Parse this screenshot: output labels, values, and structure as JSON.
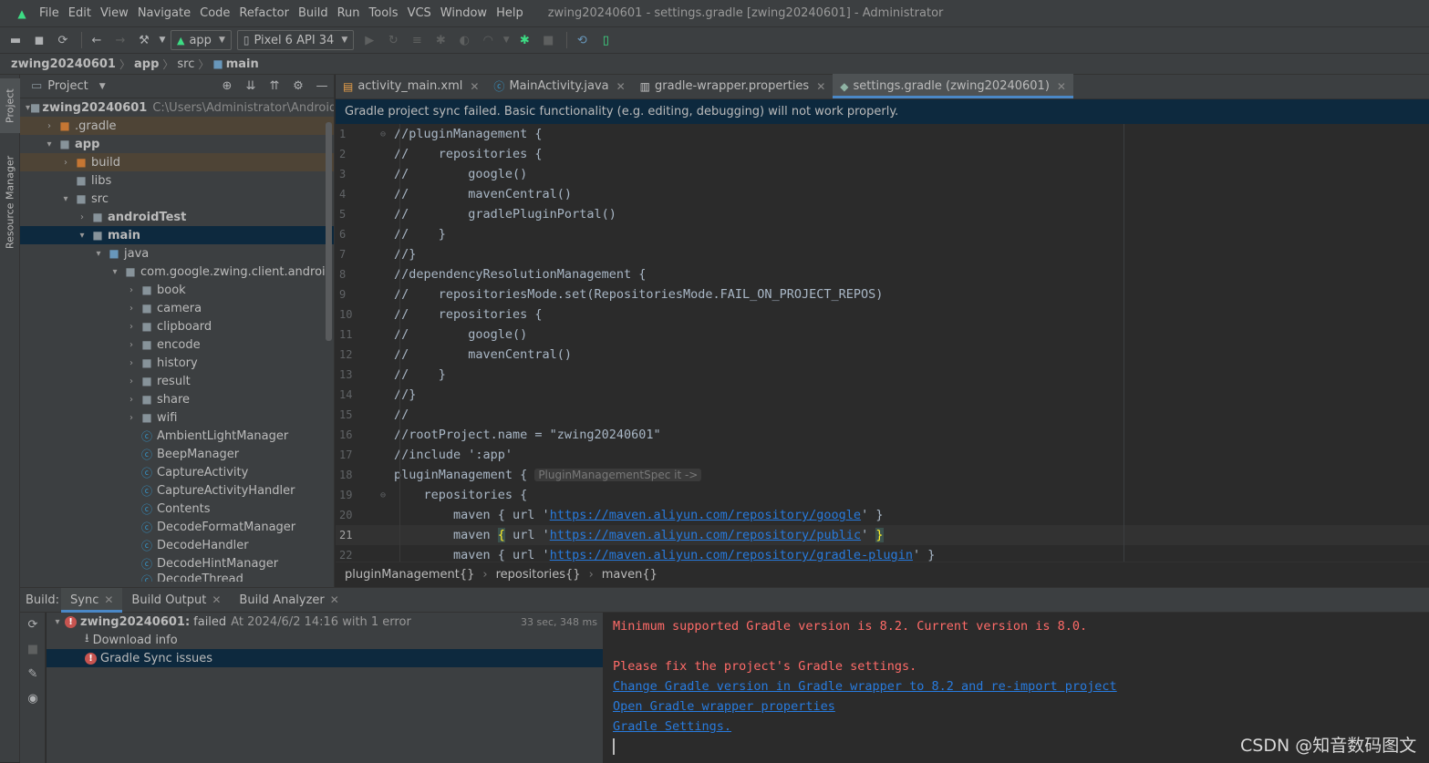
{
  "menubar": {
    "items": [
      "File",
      "Edit",
      "View",
      "Navigate",
      "Code",
      "Refactor",
      "Build",
      "Run",
      "Tools",
      "VCS",
      "Window",
      "Help"
    ],
    "title": "zwing20240601 - settings.gradle [zwing20240601] - Administrator"
  },
  "toolbar": {
    "config": "app",
    "device": "Pixel 6 API 34"
  },
  "navbar": {
    "crumbs": [
      "zwing20240601",
      "app",
      "src",
      "main"
    ]
  },
  "leftstrip": {
    "project_tab": "Project",
    "resource_tab": "Resource Manager"
  },
  "project": {
    "header": "Project",
    "tree": [
      {
        "label": "zwing20240601",
        "path": "C:\\Users\\Administrator\\AndroidStu"
      },
      {
        "label": ".gradle"
      },
      {
        "label": "app"
      },
      {
        "label": "build"
      },
      {
        "label": "libs"
      },
      {
        "label": "src"
      },
      {
        "label": "androidTest"
      },
      {
        "label": "main"
      },
      {
        "label": "java"
      },
      {
        "label": "com.google.zwing.client.android"
      },
      {
        "label": "book"
      },
      {
        "label": "camera"
      },
      {
        "label": "clipboard"
      },
      {
        "label": "encode"
      },
      {
        "label": "history"
      },
      {
        "label": "result"
      },
      {
        "label": "share"
      },
      {
        "label": "wifi"
      },
      {
        "label": "AmbientLightManager"
      },
      {
        "label": "BeepManager"
      },
      {
        "label": "CaptureActivity"
      },
      {
        "label": "CaptureActivityHandler"
      },
      {
        "label": "Contents"
      },
      {
        "label": "DecodeFormatManager"
      },
      {
        "label": "DecodeHandler"
      },
      {
        "label": "DecodeHintManager"
      },
      {
        "label": "DecodeThread"
      }
    ]
  },
  "editor": {
    "tabs": [
      "activity_main.xml",
      "MainActivity.java",
      "gradle-wrapper.properties",
      "settings.gradle (zwing20240601)"
    ],
    "banner": "Gradle project sync failed. Basic functionality (e.g. editing, debugging) will not work properly.",
    "lines": {
      "l1": "//pluginManagement {",
      "l2": "//    repositories {",
      "l3": "//        google()",
      "l4": "//        mavenCentral()",
      "l5": "//        gradlePluginPortal()",
      "l6": "//    }",
      "l7": "//}",
      "l8": "//dependencyResolutionManagement {",
      "l9": "//    repositoriesMode.set(RepositoriesMode.FAIL_ON_PROJECT_REPOS)",
      "l10": "//    repositories {",
      "l11": "//        google()",
      "l12": "//        mavenCentral()",
      "l13": "//    }",
      "l14": "//}",
      "l15": "//",
      "l16": "//rootProject.name = \"zwing20240601\"",
      "l17": "//include ':app'",
      "l18": "pluginManagement {",
      "l18_hint": "PluginManagementSpec it ->",
      "l19": "    repositories {",
      "l20_pre": "        maven { url '",
      "l20_url": "https://maven.aliyun.com/repository/google",
      "l20_post": "' }",
      "l21_pre": "        maven ",
      "l21_open": "{",
      "l21_mid": " url '",
      "l21_url": "https://maven.aliyun.com/repository/public",
      "l21_post": "' ",
      "l21_close": "}",
      "l22_pre": "        maven { url '",
      "l22_url": "https://maven.aliyun.com/repository/gradle-plugin",
      "l22_post": "' }"
    },
    "line_numbers": [
      "1",
      "2",
      "3",
      "4",
      "5",
      "6",
      "7",
      "8",
      "9",
      "10",
      "11",
      "12",
      "13",
      "14",
      "15",
      "16",
      "17",
      "18",
      "19",
      "20",
      "21",
      "22"
    ],
    "breadcrumb": [
      "pluginManagement{}",
      "repositories{}",
      "maven{}"
    ]
  },
  "build": {
    "label": "Build:",
    "tabs": [
      "Sync",
      "Build Output",
      "Build Analyzer"
    ],
    "tree": {
      "root_name": "zwing20240601:",
      "root_status": "failed",
      "root_detail": "At 2024/6/2 14:16 with 1 error",
      "root_time": "33 sec, 348 ms",
      "download": "Download info",
      "issues": "Gradle Sync issues"
    },
    "output": {
      "line1": "Minimum supported Gradle version is 8.2. Current version is 8.0.",
      "line2": "Please fix the project's Gradle settings.",
      "link1": "Change Gradle version in Gradle wrapper to 8.2 and re-import project",
      "link2": "Open Gradle wrapper properties",
      "link3": "Gradle Settings."
    }
  },
  "watermark": "CSDN @知音数码图文"
}
